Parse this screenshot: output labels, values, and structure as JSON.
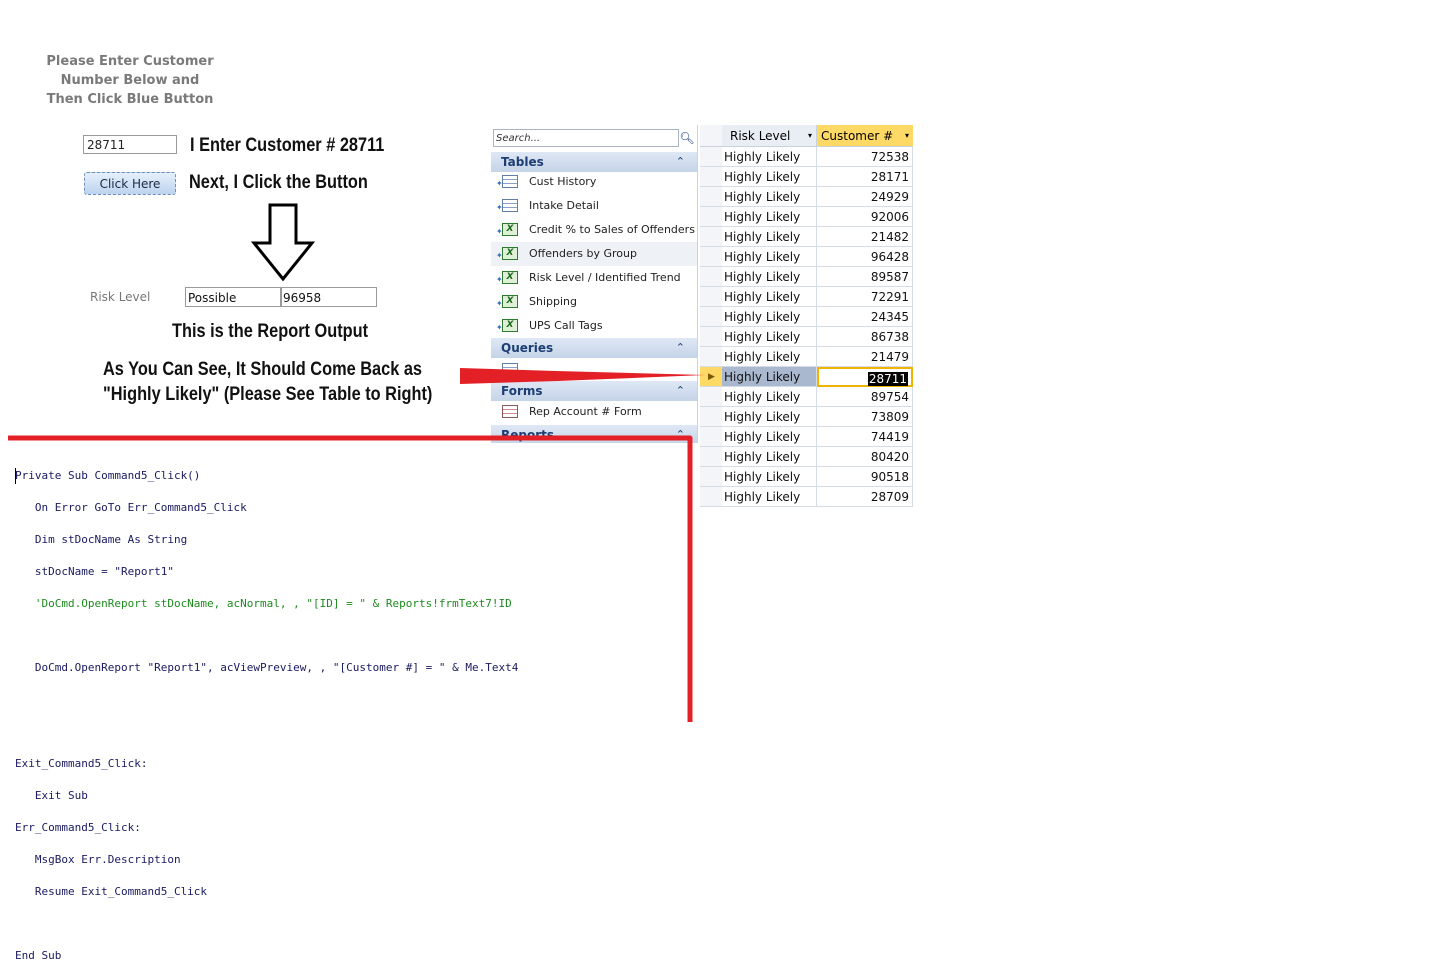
{
  "instructions": {
    "line1": "Please Enter Customer",
    "line2": "Number Below and",
    "line3": "Then Click Blue Button"
  },
  "form": {
    "customer_value": "28711",
    "enter_note": "I Enter Customer # 28711",
    "button_label": "Click Here",
    "click_note": "Next, I Click the Button",
    "risk_level_label": "Risk Level",
    "risk_level_value": "Possible",
    "customer_output": "96958",
    "report_note": "This is the Report Output",
    "explain_line1": "As You Can See, It Should Come Back as",
    "explain_line2": "\"Highly Likely\" (Please See Table to Right)"
  },
  "nav_pane": {
    "search_placeholder": "Search...",
    "search_icon": "magnifier-icon",
    "groups": {
      "tables": {
        "label": "Tables"
      },
      "queries": {
        "label": "Queries"
      },
      "forms": {
        "label": "Forms"
      },
      "reports": {
        "label": "Reports"
      }
    },
    "tables": [
      {
        "label": "Cust History",
        "icon": "table-icon"
      },
      {
        "label": "Intake Detail",
        "icon": "table-icon"
      },
      {
        "label": "Credit % to Sales of Offenders",
        "icon": "excel-link-icon"
      },
      {
        "label": "Offenders by Group",
        "icon": "excel-link-icon"
      },
      {
        "label": "Risk Level / Identified Trend",
        "icon": "excel-link-icon"
      },
      {
        "label": "Shipping",
        "icon": "excel-link-icon"
      },
      {
        "label": "UPS Call Tags",
        "icon": "excel-link-icon"
      }
    ],
    "forms": [
      {
        "label": "Rep Account # Form",
        "icon": "form-icon"
      }
    ]
  },
  "datasheet": {
    "col_risk": "Risk Level",
    "col_customer": "Customer #",
    "rows": [
      {
        "risk": "Highly Likely",
        "customer": "72538"
      },
      {
        "risk": "Highly Likely",
        "customer": "28171"
      },
      {
        "risk": "Highly Likely",
        "customer": "24929"
      },
      {
        "risk": "Highly Likely",
        "customer": "92006"
      },
      {
        "risk": "Highly Likely",
        "customer": "21482"
      },
      {
        "risk": "Highly Likely",
        "customer": "96428"
      },
      {
        "risk": "Highly Likely",
        "customer": "89587"
      },
      {
        "risk": "Highly Likely",
        "customer": "72291"
      },
      {
        "risk": "Highly Likely",
        "customer": "24345"
      },
      {
        "risk": "Highly Likely",
        "customer": "86738"
      },
      {
        "risk": "Highly Likely",
        "customer": "21479"
      },
      {
        "risk": "Highly Likely",
        "customer": "28711"
      },
      {
        "risk": "Highly Likely",
        "customer": "89754"
      },
      {
        "risk": "Highly Likely",
        "customer": "73809"
      },
      {
        "risk": "Highly Likely",
        "customer": "74419"
      },
      {
        "risk": "Highly Likely",
        "customer": "80420"
      },
      {
        "risk": "Highly Likely",
        "customer": "90518"
      },
      {
        "risk": "Highly Likely",
        "customer": "28709"
      }
    ],
    "selected_customer": "28711"
  },
  "code": {
    "l1": "Private Sub Command5_Click()",
    "l2": "   On Error GoTo Err_Command5_Click",
    "l3": "   Dim stDocName As String",
    "l4": "   stDocName = \"Report1\"",
    "l5": "   'DoCmd.OpenReport stDocName, acNormal, , \"[ID] = \" & Reports!frmText7!ID",
    "l6": "   DoCmd.OpenReport \"Report1\", acViewPreview, , \"[Customer #] = \" & Me.Text4",
    "l7": "Exit_Command5_Click:",
    "l8": "   Exit Sub",
    "l9": "Err_Command5_Click:",
    "l10": "   MsgBox Err.Description",
    "l11": "   Resume Exit_Command5_Click",
    "l12": "End Sub"
  },
  "colors": {
    "annotation_red": "#e32026",
    "header_highlight": "#ffd966",
    "selected_row": "#a9b8cf"
  }
}
